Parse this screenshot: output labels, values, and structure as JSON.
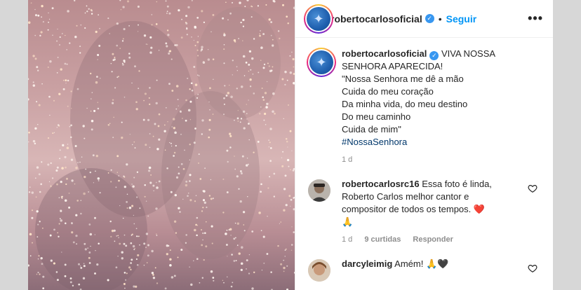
{
  "post": {
    "username": "robertocarlosoficial",
    "follow_label": "Seguir",
    "more_label": "•••",
    "separator": "•"
  },
  "caption": {
    "username": "robertocarlosoficial",
    "lines": [
      "VIVA NOSSA",
      "SENHORA APARECIDA!",
      "\"Nossa Senhora me dê a mão",
      "Cuida do meu coração",
      "Da minha vida, do meu destino",
      "Do meu caminho",
      "Cuida de mim\""
    ],
    "hashtag": "#NossaSenhora",
    "time": "1 d"
  },
  "comments": [
    {
      "username": "robertocarlosrc16",
      "text_lines": [
        "Essa foto é linda,",
        "Roberto Carlos melhor cantor e",
        "compositor de todos os tempos."
      ],
      "emoji_heart": "❤️",
      "emoji_pray": "🙏",
      "time": "1 d",
      "likes": "9 curtidas",
      "reply": "Responder"
    },
    {
      "username": "darcyleimig",
      "text": "Amém!",
      "emoji": "🙏🖤"
    }
  ],
  "icons": [
    "verified-badge-icon",
    "more-options-icon",
    "heart-outline-icon"
  ],
  "colors": {
    "link": "#0095f6",
    "hashtag": "#00376b",
    "muted": "#8e8e8e"
  }
}
